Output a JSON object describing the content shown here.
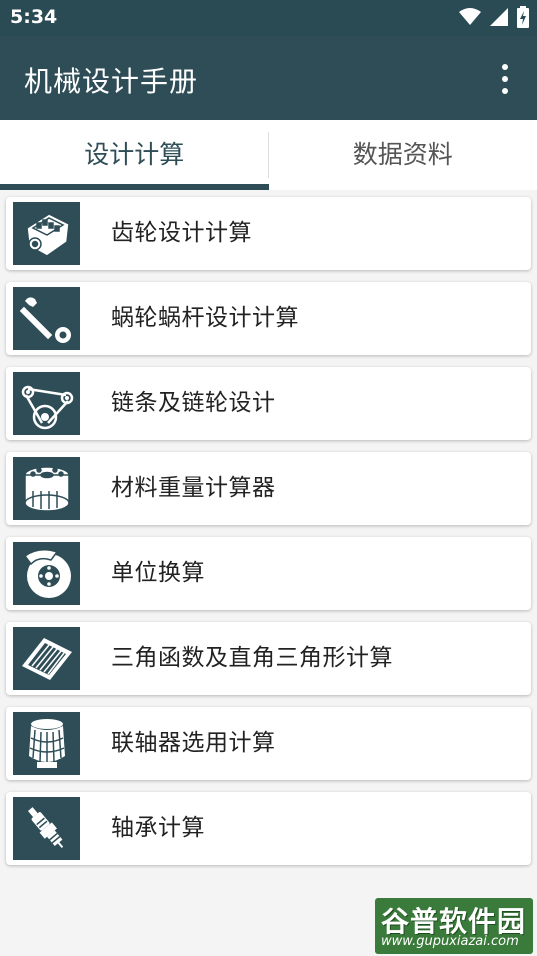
{
  "status_bar": {
    "time": "5:34",
    "icons": [
      "wifi-icon",
      "signal-icon",
      "battery-icon"
    ]
  },
  "app_bar": {
    "title": "机械设计手册",
    "menu_icon": "more-vert-icon"
  },
  "tabs": [
    {
      "label": "设计计算",
      "active": true
    },
    {
      "label": "数据资料",
      "active": false
    }
  ],
  "items": [
    {
      "label": "齿轮设计计算",
      "icon": "engine-icon"
    },
    {
      "label": "蜗轮蜗杆设计计算",
      "icon": "wrench-icon"
    },
    {
      "label": "链条及链轮设计",
      "icon": "chain-belt-icon"
    },
    {
      "label": "材料重量计算器",
      "icon": "oil-filter-icon"
    },
    {
      "label": "单位换算",
      "icon": "brake-disc-icon"
    },
    {
      "label": "三角函数及直角三角形计算",
      "icon": "air-filter-icon"
    },
    {
      "label": "联轴器选用计算",
      "icon": "cone-filter-icon"
    },
    {
      "label": "轴承计算",
      "icon": "spark-plug-icon"
    }
  ],
  "watermark": {
    "title": "谷普软件园",
    "url": "www.gupuxiazai.com"
  },
  "colors": {
    "primary": "#2e4d57",
    "status_bar": "#2a4a54",
    "background": "#f4f4f4"
  }
}
